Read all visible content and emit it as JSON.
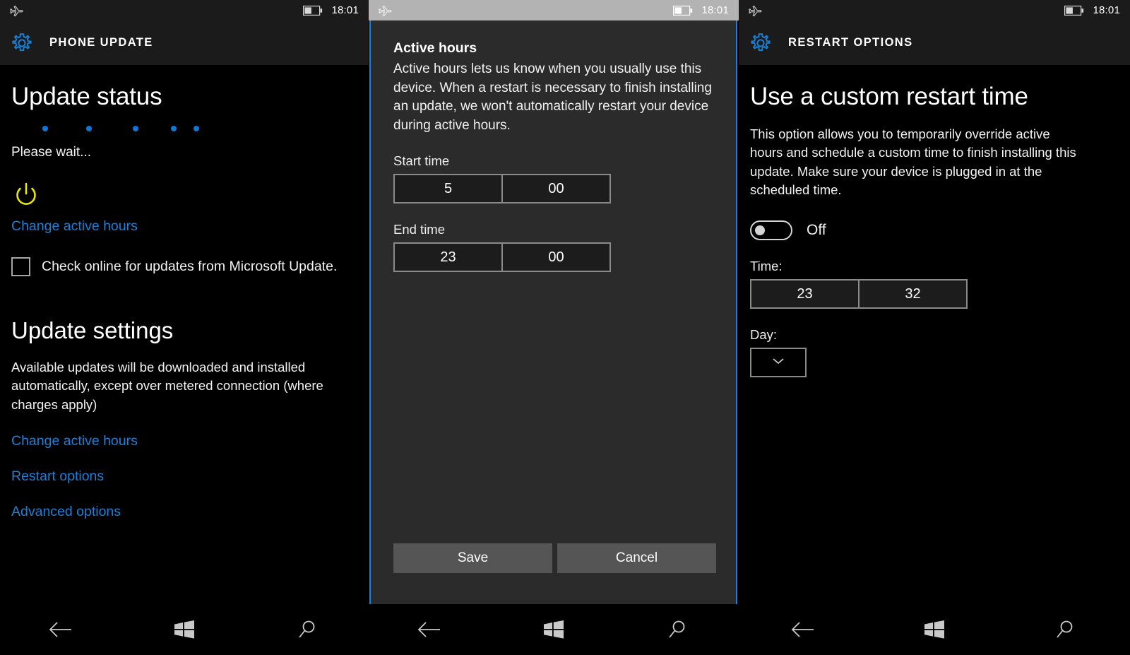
{
  "colors": {
    "accent_blue": "#1d7fd6",
    "power_yellow": "#e8e800",
    "dialog_border": "#1b7fd4",
    "header_bg": "#1b1b1b",
    "dialog_bg": "#2b2b2b"
  },
  "panel_left": {
    "status_bar": {
      "airplane_icon": "airplane-mode-icon",
      "battery_icon": "battery-icon",
      "time": "18:01"
    },
    "header": {
      "icon": "gear-icon",
      "title": "PHONE UPDATE"
    },
    "page_title": "Update status",
    "progress_dots": 5,
    "status_text": "Please wait...",
    "power_icon": "power-icon",
    "change_active_hours_link": "Change active hours",
    "checkbox": {
      "label": "Check online for updates from Microsoft Update.",
      "checked": false
    },
    "section_title": "Update settings",
    "section_body": "Available updates will be downloaded and installed automatically, except over metered connection (where charges apply)",
    "links": [
      {
        "label": "Change active hours"
      },
      {
        "label": "Restart options"
      },
      {
        "label": "Advanced options"
      }
    ],
    "navbar": [
      {
        "icon": "back-arrow-icon"
      },
      {
        "icon": "windows-start-icon"
      },
      {
        "icon": "search-icon"
      }
    ]
  },
  "panel_mid": {
    "status_bar": {
      "airplane_icon": "airplane-mode-icon",
      "battery_icon": "battery-icon",
      "time": "18:01"
    },
    "dialog": {
      "title": "Active hours",
      "description": "Active hours lets us know when you usually use this device. When a restart is necessary to finish installing an update, we won't automatically restart your device during active hours.",
      "start_time_label": "Start time",
      "start_time_hour": "5",
      "start_time_minute": "00",
      "end_time_label": "End time",
      "end_time_hour": "23",
      "end_time_minute": "00",
      "save_label": "Save",
      "cancel_label": "Cancel"
    },
    "navbar": [
      {
        "icon": "back-arrow-icon"
      },
      {
        "icon": "windows-start-icon"
      },
      {
        "icon": "search-icon"
      }
    ]
  },
  "panel_right": {
    "status_bar": {
      "airplane_icon": "airplane-mode-icon",
      "battery_icon": "battery-icon",
      "time": "18:01"
    },
    "header": {
      "icon": "gear-icon",
      "title": "RESTART OPTIONS"
    },
    "page_title": "Use a custom restart time",
    "description": "This option allows you to temporarily override active hours and schedule a custom time to finish installing this update. Make sure your device is plugged in at the scheduled time.",
    "toggle": {
      "state_label": "Off",
      "on": false
    },
    "time_label": "Time:",
    "time_hour": "23",
    "time_minute": "32",
    "day_label": "Day:",
    "day_value": "",
    "navbar": [
      {
        "icon": "back-arrow-icon"
      },
      {
        "icon": "windows-start-icon"
      },
      {
        "icon": "search-icon"
      }
    ]
  }
}
